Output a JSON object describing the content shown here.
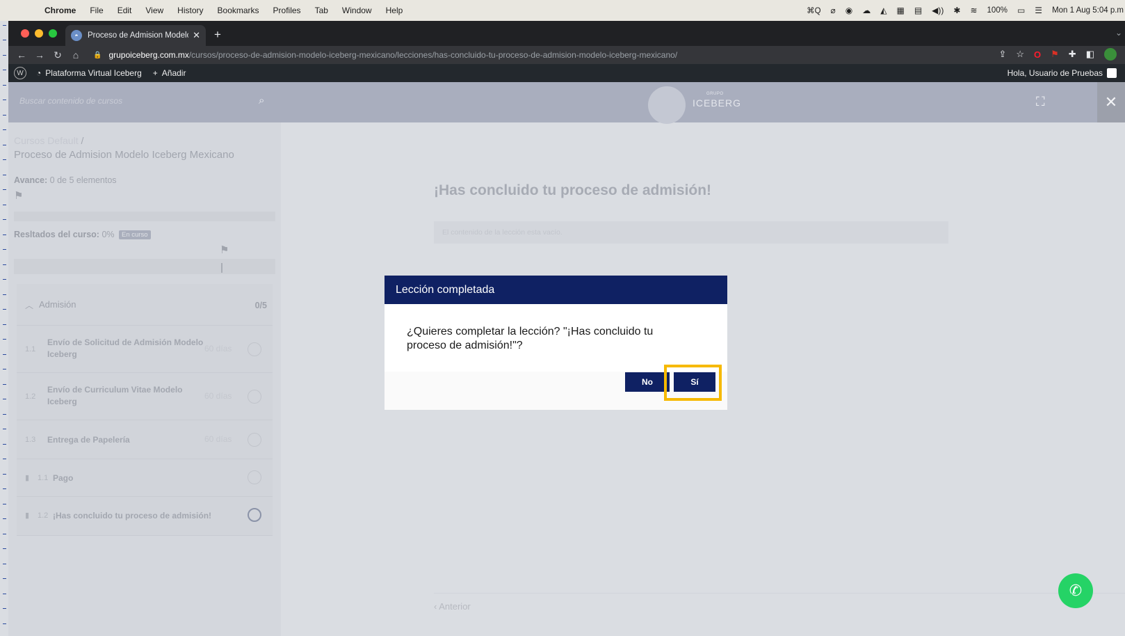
{
  "menubar": {
    "apple": "",
    "app": "Chrome",
    "items": [
      "File",
      "Edit",
      "View",
      "History",
      "Bookmarks",
      "Profiles",
      "Tab",
      "Window",
      "Help"
    ],
    "status": {
      "shortcut": "⌘Q",
      "battery": "100%",
      "datetime": "Mon 1 Aug  5:04 p.m"
    }
  },
  "browser": {
    "tab_title": "Proceso de Admision Modelo Ic",
    "url_host": "grupoiceberg.com.mx",
    "url_path": "/cursos/proceso-de-admision-modelo-iceberg-mexicano/lecciones/has-concluido-tu-proceso-de-admision-modelo-iceberg-mexicano/"
  },
  "wpbar": {
    "site_name": "Plataforma Virtual Iceberg",
    "add_label": "Añadir",
    "howdy": "Hola, Usuario de Pruebas"
  },
  "header": {
    "search_placeholder": "Buscar contenido de cursos",
    "brand_small": "GRUPO",
    "brand": "ICEBERG"
  },
  "sidebar": {
    "crumb": "Cursos Default",
    "crumb_sep": "/",
    "course_title": "Proceso de Admision Modelo Iceberg Mexicano",
    "progress_label": "Avance:",
    "progress_value": "0 de 5 elementos",
    "results_label": "Resltados del curso:",
    "results_value": "0%",
    "results_badge": "En curso",
    "section_label": "Admisión",
    "section_count": "0/5",
    "lessons": [
      {
        "num": "1.1",
        "name": "Envío de Solicitud de Admisión Modelo Iceberg",
        "days": "60 días"
      },
      {
        "num": "1.2",
        "name": "Envío de Curriculum Vitae Modelo Iceberg",
        "days": "60 días"
      },
      {
        "num": "1.3",
        "name": "Entrega de Papelería",
        "days": "60 días"
      }
    ],
    "topics": [
      {
        "num": "1.1",
        "name": "Pago"
      },
      {
        "num": "1.2",
        "name": "¡Has concluido tu proceso de admisión!"
      }
    ]
  },
  "main": {
    "title": "¡Has concluido tu proceso de admisión!",
    "empty_note": "El contenido de la lección esta vacío.",
    "prev": "Anterior"
  },
  "modal": {
    "title": "Lección completada",
    "message": "¿Quieres completar la lección? \"¡Has concluido tu proceso de admisión!\"?",
    "no_label": "No",
    "yes_label": "Sí"
  },
  "colors": {
    "modal_header": "#0f2163",
    "highlight": "#f6b900",
    "whatsapp": "#25d366"
  }
}
